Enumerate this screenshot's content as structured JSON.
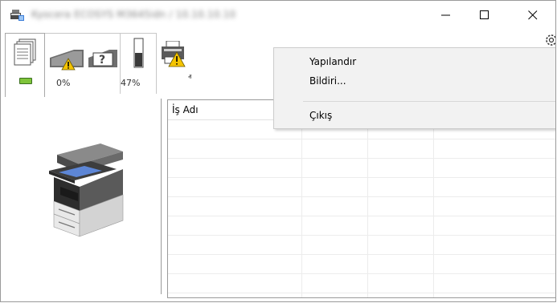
{
  "window": {
    "title": "Kyocera ECOSYS M3645idn / 10.10.10.10"
  },
  "toolbar": {
    "tabs": [
      {
        "name": "jobs",
        "icon": "document-stack-icon",
        "status_color": "#7fc43a"
      },
      {
        "name": "toner",
        "icon": "toner-warning-icon",
        "percent": "0%"
      },
      {
        "name": "paper",
        "icon": "paper-gauge-icon",
        "percent": "47%"
      },
      {
        "name": "printer-status",
        "icon": "printer-warning-icon"
      }
    ],
    "collapse_glyph": "ⱏ"
  },
  "job_list": {
    "columns": [
      "İş Adı",
      "",
      "",
      ""
    ]
  },
  "context_menu": {
    "items": [
      "Yapılandır",
      "Bildiri...",
      "Çıkış"
    ]
  },
  "colors": {
    "warning": "#f5c400",
    "status_ok": "#7fc43a"
  }
}
